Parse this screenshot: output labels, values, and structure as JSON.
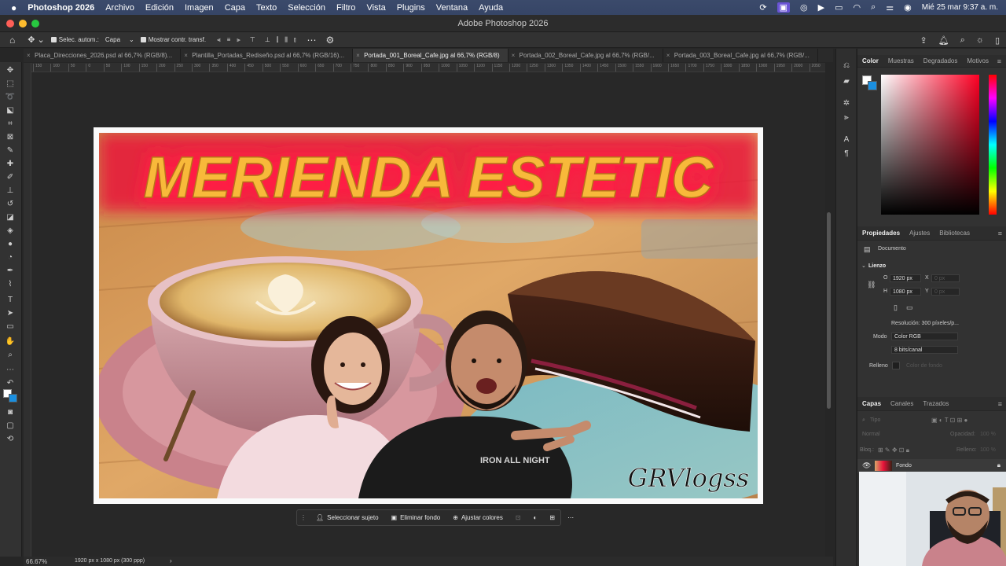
{
  "menubar": {
    "app": "Photoshop 2026",
    "items": [
      "Archivo",
      "Edición",
      "Imagen",
      "Capa",
      "Texto",
      "Selección",
      "Filtro",
      "Vista",
      "Plugins",
      "Ventana",
      "Ayuda"
    ],
    "datetime": "Mié 25 mar 9:37 a. m."
  },
  "window": {
    "title": "Adobe Photoshop 2026"
  },
  "options": {
    "auto_select_label": "Selec. autom.:",
    "auto_select_value": "Capa",
    "show_transform_label": "Mostrar contr. transf."
  },
  "tabs": [
    "Placa_Direcciones_2026.psd al 66,7% (RGB/8)...",
    "Plantilla_Portadas_Rediseño.psd al 66,7% (RGB/16)...",
    "Portada_001_Boreal_Cafe.jpg al 66,7% (RGB/8)",
    "Portada_002_Boreal_Cafe.jpg al 66,7% (RGB/...",
    "Portada_003_Boreal_Cafe.jpg al 66,7% (RGB/..."
  ],
  "active_tab": 2,
  "ruler_ticks": [
    "150",
    "100",
    "50",
    "0",
    "50",
    "100",
    "150",
    "200",
    "250",
    "300",
    "350",
    "400",
    "450",
    "500",
    "550",
    "600",
    "650",
    "700",
    "750",
    "800",
    "850",
    "900",
    "950",
    "1000",
    "1050",
    "1100",
    "1150",
    "1200",
    "1250",
    "1300",
    "1350",
    "1400",
    "1450",
    "1500",
    "1550",
    "1600",
    "1650",
    "1700",
    "1750",
    "1800",
    "1850",
    "1900",
    "1950",
    "2000",
    "2050"
  ],
  "canvas": {
    "headline": "MERIENDA ESTETIC",
    "signature": "GRVlogss",
    "tee_print": "IRON ALL NIGHT"
  },
  "context_bar": {
    "select_subject": "Seleccionar sujeto",
    "remove_bg": "Eliminar fondo",
    "adjust_colors": "Ajustar colores"
  },
  "status": {
    "zoom": "66.67%",
    "doc_info": "1920 px x 1080 px (300 ppp)"
  },
  "color_panel": {
    "tabs": [
      "Color",
      "Muestras",
      "Degradados",
      "Motivos"
    ]
  },
  "properties_panel": {
    "tabs": [
      "Propiedades",
      "Ajustes",
      "Bibliotecas"
    ],
    "document_label": "Documento",
    "canvas_section": "Lienzo",
    "width_label": "O",
    "width": "1920 px",
    "height_label": "H",
    "height": "1080 px",
    "x_label": "X",
    "y_label": "Y",
    "x_placeholder": "0 px",
    "y_placeholder": "0 px",
    "resolution": "Resolución: 300 píxeles/p...",
    "mode_label": "Modo",
    "mode_value": "Color RGB",
    "bits_value": "8 bits/canal",
    "fill_label": "Relleno",
    "fill_value": "Color de fondo"
  },
  "layers_panel": {
    "tabs": [
      "Capas",
      "Canales",
      "Trazados"
    ],
    "search_placeholder": "Tipo",
    "blend_mode": "Normal",
    "opacity_label": "Opacidad:",
    "opacity_value": "100 %",
    "lock_label": "Bloq.:",
    "fill_label": "Relleno:",
    "fill_value": "100 %",
    "layers": [
      {
        "name": "Fondo"
      }
    ]
  },
  "colors": {
    "menubar_bg": "#384769",
    "headline_fill": "#f8b93a",
    "headline_glow": "#e8123a",
    "foreground": "#ffffff",
    "background": "#1a8fe0"
  }
}
